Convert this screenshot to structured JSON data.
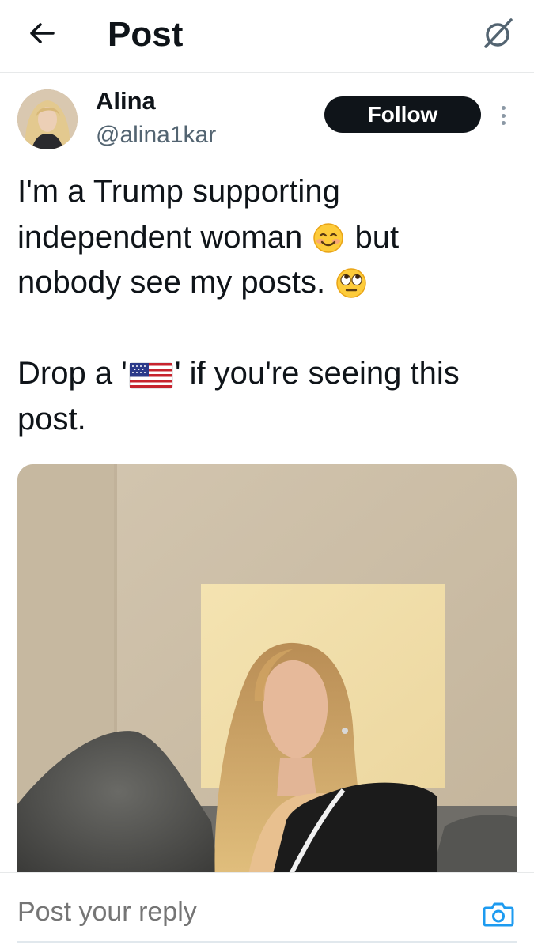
{
  "header": {
    "title": "Post",
    "back_icon": "arrow-left-icon",
    "grok_icon": "grok-slash-icon"
  },
  "author": {
    "display_name": "Alina",
    "handle": "@alina1kar",
    "follow_label": "Follow",
    "more_icon": "more-vertical-icon"
  },
  "post": {
    "line1": "I'm a Trump supporting",
    "line2_before": "independent woman",
    "line2_after": "but",
    "line3": "nobody see my posts.",
    "line4_before": "Drop a '",
    "line4_after": "' if you're seeing this",
    "line5": "post.",
    "emojis": [
      "smiling-face-with-smiling-eyes-emoji",
      "face-with-rolling-eyes-emoji",
      "us-flag-emoji"
    ]
  },
  "media": {
    "type": "photo"
  },
  "reply": {
    "placeholder": "Post your reply",
    "camera_icon": "camera-icon"
  },
  "colors": {
    "text": "#0f1419",
    "secondary": "#536471",
    "accent": "#1d9bf0",
    "follow_bg": "#0f1419"
  }
}
